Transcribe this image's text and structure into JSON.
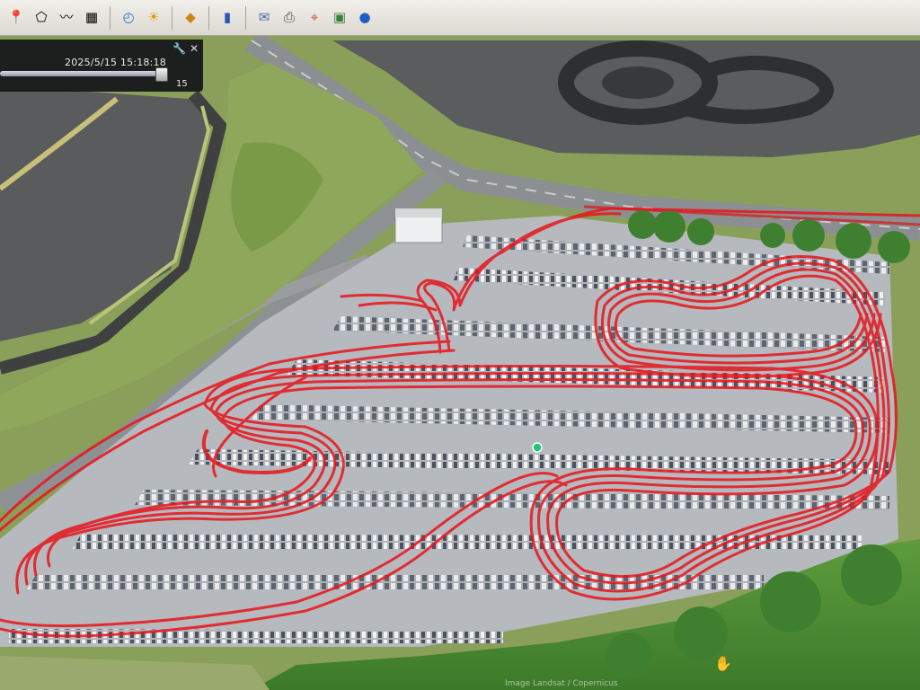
{
  "toolbar": {
    "icons": [
      "placemark-icon",
      "polygon-icon",
      "path-icon",
      "overlay-icon",
      "historical-imagery-icon",
      "sunlight-icon",
      "planets-icon",
      "ruler-icon",
      "email-icon",
      "print-icon",
      "google-maps-icon",
      "save-image-icon",
      "earth-icon"
    ]
  },
  "time_slider": {
    "datetime": "2025/5/15  15:18:18",
    "count": "15",
    "progress": 0.96
  },
  "attribution": "Image Landsat / Copernicus",
  "colors": {
    "track": "#e8141c",
    "asphalt": "#4f5051",
    "grass": "#8ea45a",
    "trees": "#4f8a35",
    "lot": "#b6b9bd"
  }
}
